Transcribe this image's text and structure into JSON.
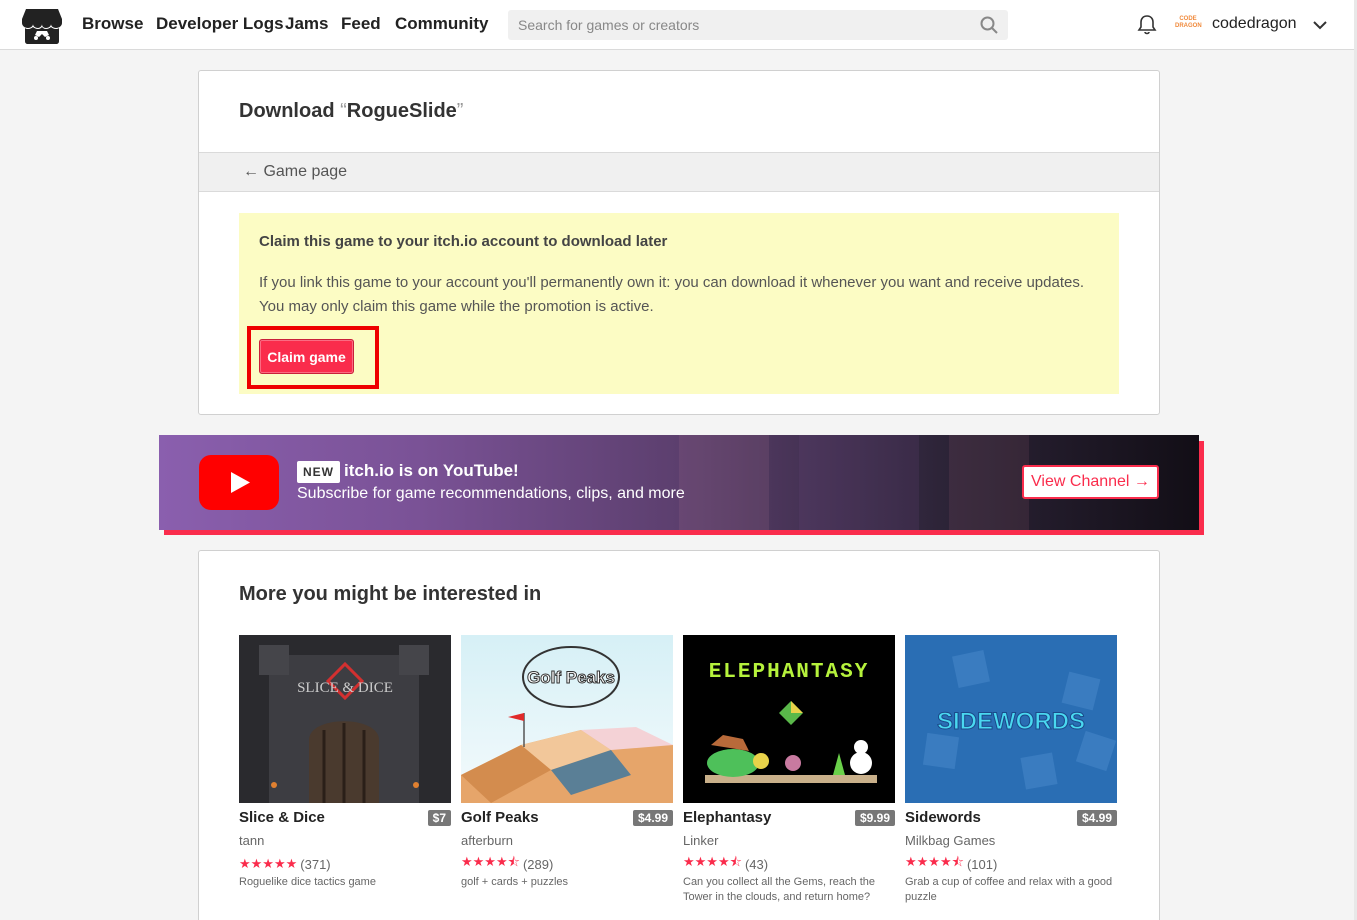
{
  "header": {
    "nav": [
      "Browse",
      "Developer Logs",
      "Jams",
      "Feed",
      "Community"
    ],
    "search_placeholder": "Search for games or creators",
    "avatar_text": "CODE DRAGON",
    "username": "codedragon"
  },
  "download": {
    "title_prefix": "Download",
    "open_quote": "“",
    "game_name": "RogueSlide",
    "close_quote": "”",
    "back_link": "← Game page",
    "claim_heading": "Claim this game to your itch.io account to download later",
    "claim_text": "If you link this game to your account you'll permanently own it: you can download it whenever you want and receive updates. You may only claim this game while the promotion is active.",
    "claim_button": "Claim game"
  },
  "youtube": {
    "badge": "NEW",
    "title": "itch.io is on YouTube!",
    "subtitle": "Subscribe for game recommendations, clips, and more",
    "button": "View Channel →"
  },
  "recommendations": {
    "title": "More you might be interested in",
    "games": [
      {
        "title": "Slice & Dice",
        "price": "$7",
        "author": "tann",
        "stars": "★★★★★",
        "rating_count": "(371)",
        "description": "Roguelike dice tactics game",
        "thumb_text": "SLICE & DICE"
      },
      {
        "title": "Golf Peaks",
        "price": "$4.99",
        "author": "afterburn",
        "stars": "★★★★⯪",
        "rating_count": "(289)",
        "description": "golf + cards + puzzles",
        "thumb_text": "Golf Peaks"
      },
      {
        "title": "Elephantasy",
        "price": "$9.99",
        "author": "Linker",
        "stars": "★★★★⯪",
        "rating_count": "(43)",
        "description": "Can you collect all the Gems, reach the Tower in the clouds, and return home?",
        "thumb_text": "ELEPHANTASY"
      },
      {
        "title": "Sidewords",
        "price": "$4.99",
        "author": "Milkbag Games",
        "stars": "★★★★⯪",
        "rating_count": "(101)",
        "description": "Grab a cup of coffee and relax with a good puzzle",
        "thumb_text": "SIDEWORDS"
      }
    ]
  },
  "colors": {
    "accent": "#fa2c4c",
    "claim_bg": "#fcfcc4",
    "youtube_red": "#ff0000"
  }
}
